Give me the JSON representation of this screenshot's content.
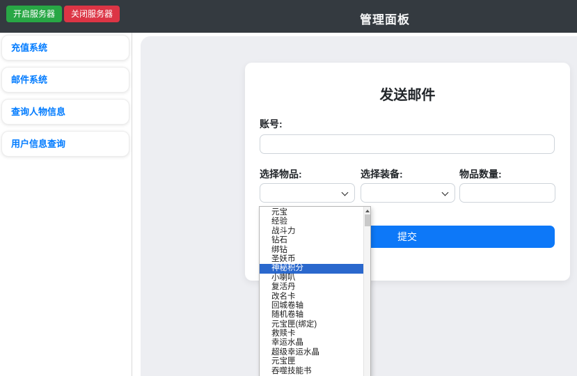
{
  "colors": {
    "navbar_bg": "#343a40",
    "start_green": "#28a745",
    "stop_red": "#dc3545",
    "link_blue": "#007bff",
    "submit_blue": "#0d78f8",
    "highlight_blue": "#2a68cd",
    "panel_gray": "#edeef2"
  },
  "navbar": {
    "title": "管理面板",
    "start_button": "开启服务器",
    "stop_button": "关闭服务器"
  },
  "sidebar": {
    "items": [
      {
        "label": "充值系统"
      },
      {
        "label": "邮件系统"
      },
      {
        "label": "查询人物信息"
      },
      {
        "label": "用户信息查询"
      }
    ]
  },
  "form": {
    "title": "发送邮件",
    "account_label": "账号:",
    "account_value": "",
    "item_label": "选择物品:",
    "item_selected_value": "",
    "equip_label": "选择装备:",
    "equip_selected_value": "",
    "qty_label": "物品数量:",
    "qty_value": "",
    "submit_label": "提交"
  },
  "dropdown": {
    "options": [
      "元宝",
      "经验",
      "战斗力",
      "钻石",
      "绑钻",
      "圣妖币",
      "神秘积分",
      "小喇叭",
      "复活丹",
      "改名卡",
      "回城卷轴",
      "随机卷轴",
      "元宝匣(绑定)",
      "救赎卡",
      "幸运水晶",
      "超级幸运水晶",
      "元宝匣",
      "吞噬技能书"
    ],
    "highlighted_option": "神秘积分",
    "highlighted_index": 6
  }
}
